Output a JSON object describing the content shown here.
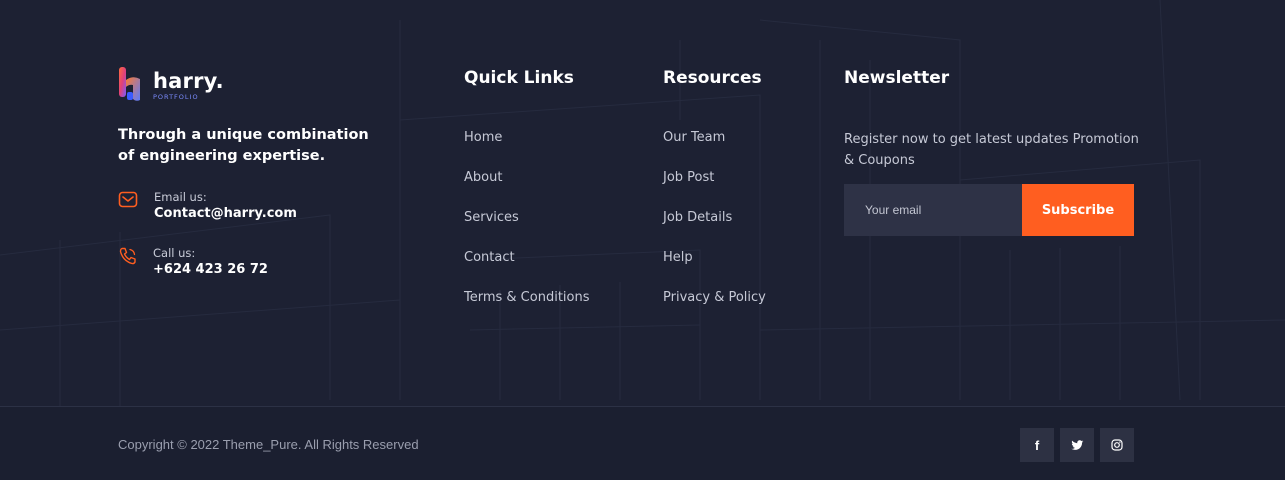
{
  "brand": {
    "name": "harry.",
    "subtitle": "PORTFOLIO",
    "tagline": "Through a unique combination of engineering expertise."
  },
  "contact": {
    "email_label": "Email us:",
    "email_value": "Contact@harry.com",
    "phone_label": "Call us:",
    "phone_value": "+624 423 26 72"
  },
  "quick_links": {
    "title": "Quick Links",
    "items": [
      {
        "label": "Home"
      },
      {
        "label": "About"
      },
      {
        "label": "Services"
      },
      {
        "label": "Contact"
      },
      {
        "label": "Terms & Conditions"
      }
    ]
  },
  "resources": {
    "title": "Resources",
    "items": [
      {
        "label": "Our Team"
      },
      {
        "label": "Job Post"
      },
      {
        "label": "Job Details"
      },
      {
        "label": "Help"
      },
      {
        "label": "Privacy & Policy"
      }
    ]
  },
  "newsletter": {
    "title": "Newsletter",
    "description": "Register now to get latest updates Promotion & Coupons",
    "placeholder": "Your email",
    "button_label": "Subscribe"
  },
  "bottom": {
    "copyright": "Copyright © 2022 Theme_Pure. All Rights Reserved",
    "social": [
      {
        "icon": "facebook-icon",
        "glyph": "f"
      },
      {
        "icon": "twitter-icon"
      },
      {
        "icon": "instagram-icon"
      }
    ]
  },
  "colors": {
    "background": "#1d2133",
    "accent": "#ff5e20",
    "input_bg": "#2e3246"
  }
}
